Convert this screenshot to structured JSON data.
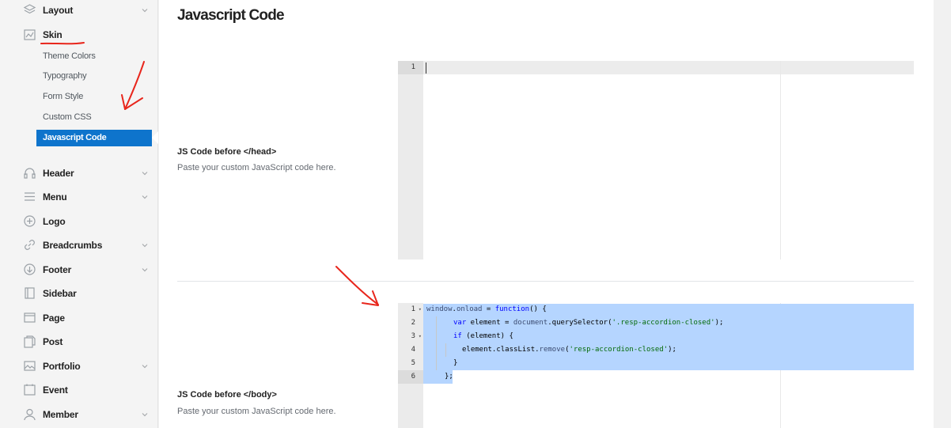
{
  "sidebar": {
    "top_items": [
      {
        "label": "Layout",
        "icon": "layers-icon",
        "has_chevron": true
      },
      {
        "label": "Skin",
        "icon": "paint-icon",
        "has_chevron": false
      }
    ],
    "sub_items": [
      "Theme Colors",
      "Typography",
      "Form Style",
      "Custom CSS"
    ],
    "active_sub_item": "Javascript Code",
    "bottom_items": [
      {
        "label": "Header",
        "icon": "headphones-icon",
        "has_chevron": true
      },
      {
        "label": "Menu",
        "icon": "hamburger-icon",
        "has_chevron": true
      },
      {
        "label": "Logo",
        "icon": "plus-circle-icon",
        "has_chevron": false
      },
      {
        "label": "Breadcrumbs",
        "icon": "link-icon",
        "has_chevron": true
      },
      {
        "label": "Footer",
        "icon": "arrow-down-circle-icon",
        "has_chevron": true
      },
      {
        "label": "Sidebar",
        "icon": "sidebar-icon",
        "has_chevron": false
      },
      {
        "label": "Page",
        "icon": "page-icon",
        "has_chevron": false
      },
      {
        "label": "Post",
        "icon": "post-icon",
        "has_chevron": false
      },
      {
        "label": "Portfolio",
        "icon": "image-icon",
        "has_chevron": true
      },
      {
        "label": "Event",
        "icon": "calendar-icon",
        "has_chevron": false
      },
      {
        "label": "Member",
        "icon": "user-icon",
        "has_chevron": true
      }
    ]
  },
  "main": {
    "title": "Javascript Code",
    "head_field": {
      "label": "JS Code before </head>",
      "description": "Paste your custom JavaScript code here.",
      "line_numbers": [
        "1"
      ]
    },
    "body_field": {
      "label": "JS Code before </body>",
      "description": "Paste your custom JavaScript code here.",
      "line_numbers": [
        "1",
        "2",
        "3",
        "4",
        "5",
        "6"
      ],
      "code": {
        "l1_obj": "window",
        "l1_dot": ".",
        "l1_prop": "onload",
        "l1_eq": " = ",
        "l1_kw": "function",
        "l1_rest": "() {",
        "l2_kw": "var",
        "l2_mid": " element = ",
        "l2_obj": "document",
        "l2_call": ".querySelector(",
        "l2_str": "'.resp-accordion-closed'",
        "l2_end": ");",
        "l3_kw": "if",
        "l3_rest": " (element) {",
        "l4_obj": "element.classList.",
        "l4_fn": "remove",
        "l4_open": "(",
        "l4_str": "'resp-accordion-closed'",
        "l4_end": ");",
        "l5": "}",
        "l6": "};"
      }
    }
  },
  "colors": {
    "accent": "#0e74cc",
    "selection": "#b5d5ff",
    "annotation": "#e8261c"
  }
}
